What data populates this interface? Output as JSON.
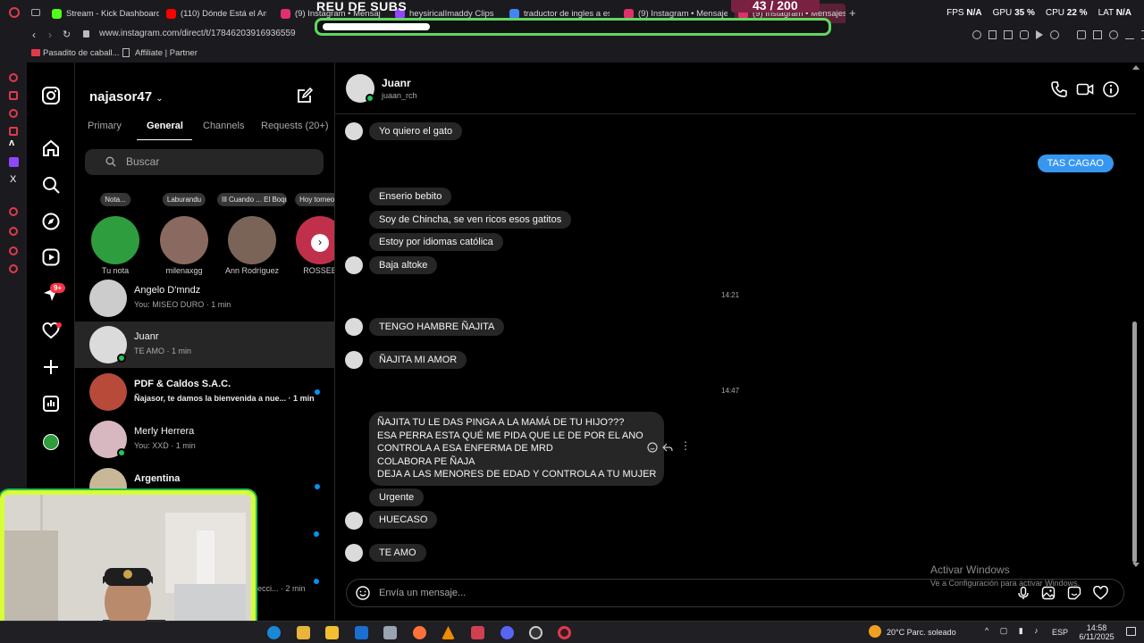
{
  "browser": {
    "tabs": [
      {
        "label": "Stream - Kick Dashboard",
        "color": "#53fc18"
      },
      {
        "label": "(110) Dónde Está el Amor",
        "color": "#ff0000"
      },
      {
        "label": "(9) Instagram • Mensajes",
        "color": "#e1306c"
      },
      {
        "label": "heysiricalImaddy Clips",
        "color": "#9146ff"
      },
      {
        "label": "traductor de ingles a esp",
        "color": "#4285f4"
      },
      {
        "label": "(9) Instagram • Mensajes",
        "color": "#e1306c"
      },
      {
        "label": "(9) Instagram • Mensajes",
        "color": "#e1306c"
      }
    ],
    "new_tab": "+",
    "url": "www.instagram.com/direct/t/17846203916936559",
    "bookmarks": [
      "Pasadito de caball...",
      "Affiliate | Partner"
    ],
    "stats": {
      "fps_label": "FPS",
      "fps": "N/A",
      "gpu_label": "GPU",
      "gpu": "35 %",
      "cpu_label": "CPU",
      "cpu": "22 %",
      "lat_label": "LAT",
      "lat": "N/A"
    }
  },
  "stream_overlay": {
    "title": "REU DE SUBS",
    "count": "43 / 200",
    "progress": 0.215,
    "bar_color": "#5fd85f"
  },
  "rail": {
    "icons": [
      "instagram-icon",
      "home-icon",
      "search-icon",
      "explore-icon",
      "reels-icon",
      "messages-icon",
      "notifications-icon",
      "create-icon",
      "dashboard-icon",
      "profile-icon"
    ],
    "messages_badge": "9+"
  },
  "inbox": {
    "account": "najasor47",
    "tabs": [
      "Primary",
      "General",
      "Channels",
      "Requests (20+)"
    ],
    "active_tab": "General",
    "search_placeholder": "Buscar",
    "notes": [
      {
        "bubble": "Nota...",
        "name": "Tu nota",
        "color": "#2e9d3e"
      },
      {
        "bubble": "Laburandu",
        "name": "milenaxgg",
        "color": "#8a6a60"
      },
      {
        "bubble": "Ill Cuando ... El Boqueto, Yu...",
        "name": "Ann Rodríguez",
        "color": "#7a6458"
      },
      {
        "bubble": "Hoy torneo 8",
        "name": "ROSSEE",
        "color": "#c0304a"
      }
    ],
    "conversations": [
      {
        "name": "Angelo D'mndz",
        "preview": "You: MISEO DURO · 1 min",
        "unread": false,
        "online": false,
        "color": "#cccccc"
      },
      {
        "name": "Juanr",
        "preview": "TE AMO · 1 min",
        "unread": false,
        "online": true,
        "color": "#dbdbdb"
      },
      {
        "name": "PDF & Caldos S.A.C.",
        "preview": "Ñajasor, te damos la bienvenida a nue... · 1 min",
        "unread": true,
        "online": false,
        "color": "#b84a3a"
      },
      {
        "name": "Merly Herrera",
        "preview": "You: XXD · 1 min",
        "unread": false,
        "online": true,
        "color": "#d8b8c0"
      },
      {
        "name": "Argentina",
        "preview": "",
        "unread": true,
        "online": false,
        "color": "#c8b898"
      }
    ],
    "partial_preview": "ecci... · 2 min"
  },
  "chat": {
    "contact_name": "Juanr",
    "contact_user": "juaan_rch",
    "messages": [
      {
        "text": "Yo quiero el gato",
        "mine": false
      },
      {
        "text": "TAS CAGAO",
        "mine": true
      },
      {
        "text": "Enserio bebito",
        "mine": false
      },
      {
        "text": "Soy de Chincha, se ven ricos esos gatitos",
        "mine": false
      },
      {
        "text": "Estoy por idiomas católica",
        "mine": false
      },
      {
        "text": "Baja altoke",
        "mine": false
      },
      {
        "text": "TENGO HAMBRE ÑAJITA",
        "mine": false
      },
      {
        "text": "ÑAJITA MI AMOR",
        "mine": false
      },
      {
        "text": "Urgente",
        "mine": false
      },
      {
        "text": "HUECASO",
        "mine": false
      },
      {
        "text": "TE AMO",
        "mine": false
      }
    ],
    "long_message": [
      "ÑAJITA TU LE DAS PINGA A LA MAMÁ DE TU HIJO???",
      "ESA PERRA ESTA QUÉ ME PIDA QUE LE DE POR EL ANO",
      "CONTROLA A ESA ENFERMA DE MRD",
      "COLABORA PE ÑAJA",
      "DEJA A LAS MENORES DE EDAD Y CONTROLA A TU MUJER"
    ],
    "timestamps": [
      "14:21",
      "14:47"
    ],
    "compose_placeholder": "Envía un mensaje..."
  },
  "watermark": {
    "title": "Activar Windows",
    "subtitle": "Ve a Configuración para activar Windows."
  },
  "taskbar": {
    "weather": "20°C  Parc. soleado",
    "lang": "ESP",
    "time": "14:58",
    "date": "6/11/2025"
  }
}
